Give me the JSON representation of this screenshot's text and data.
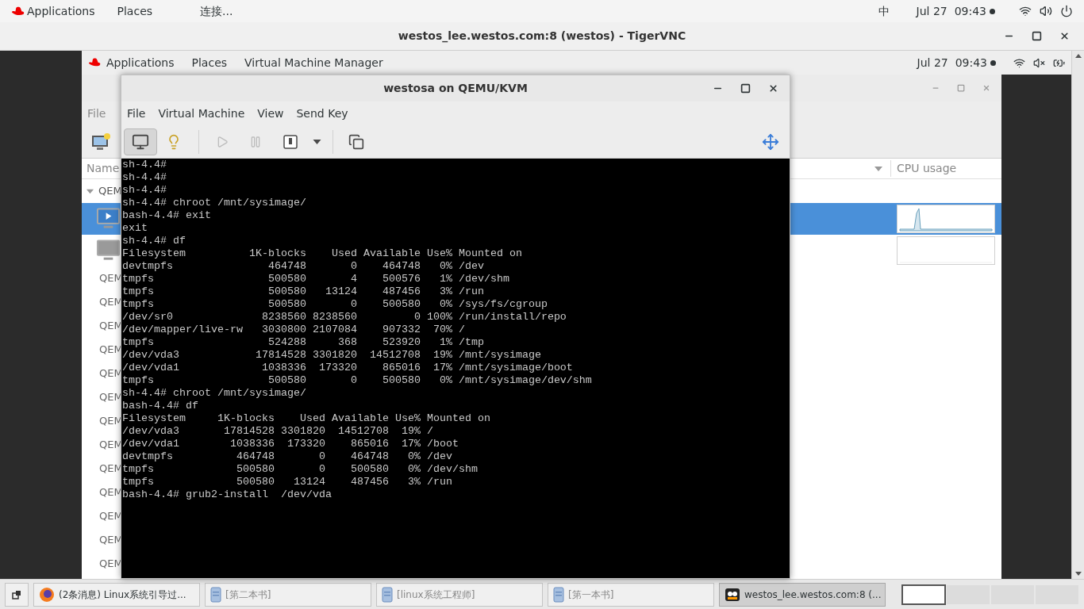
{
  "top_bar": {
    "menus": [
      "Applications",
      "Places"
    ],
    "app": "连接...",
    "input_method": "中",
    "clock": "Jul 27  09:43"
  },
  "vnc_window": {
    "title": "westos_lee.westos.com:8 (westos) - TigerVNC"
  },
  "remote_desktop": {
    "top_bar": {
      "menus": [
        "Applications",
        "Places",
        "Virtual Machine Manager"
      ],
      "clock": "Jul 27  09:43"
    },
    "manager_window": {
      "menus": [
        "File"
      ],
      "columns": [
        "Name",
        "CPU usage"
      ],
      "group": {
        "label": "QEM",
        "expanded": true
      },
      "vms": [
        {
          "selected": true,
          "running": true
        },
        {
          "selected": false,
          "running": false
        }
      ],
      "hosts": [
        "QEM",
        "QEM",
        "QEM",
        "QEM",
        "QEM",
        "QEM",
        "QEM",
        "QEM",
        "QEM",
        "QEM",
        "QEM",
        "QEM",
        "QEM"
      ]
    },
    "vm_window": {
      "title": "westosa on QEMU/KVM",
      "menus": [
        "File",
        "Virtual Machine",
        "View",
        "Send Key"
      ],
      "toolbar": [
        {
          "kind": "console",
          "selected": true,
          "disabled": false
        },
        {
          "kind": "details",
          "selected": false,
          "disabled": false
        },
        {
          "kind": "run",
          "selected": false,
          "disabled": true
        },
        {
          "kind": "pause",
          "selected": false,
          "disabled": true
        },
        {
          "kind": "shutdown",
          "selected": false,
          "disabled": false
        },
        {
          "kind": "menu",
          "selected": false,
          "disabled": false
        },
        {
          "kind": "snapshots",
          "selected": false,
          "disabled": false
        },
        {
          "kind": "fullscreen",
          "selected": false,
          "disabled": false
        }
      ],
      "console_lines": [
        "sh-4.4#",
        "sh-4.4#",
        "sh-4.4#",
        "sh-4.4# chroot /mnt/sysimage/",
        "bash-4.4# exit",
        "exit",
        "sh-4.4# df",
        "Filesystem          1K-blocks    Used Available Use% Mounted on",
        "devtmpfs               464748       0    464748   0% /dev",
        "tmpfs                  500580       4    500576   1% /dev/shm",
        "tmpfs                  500580   13124    487456   3% /run",
        "tmpfs                  500580       0    500580   0% /sys/fs/cgroup",
        "/dev/sr0              8238560 8238560         0 100% /run/install/repo",
        "/dev/mapper/live-rw   3030800 2107084    907332  70% /",
        "tmpfs                  524288     368    523920   1% /tmp",
        "/dev/vda3            17814528 3301820  14512708  19% /mnt/sysimage",
        "/dev/vda1             1038336  173320    865016  17% /mnt/sysimage/boot",
        "tmpfs                  500580       0    500580   0% /mnt/sysimage/dev/shm",
        "sh-4.4# chroot /mnt/sysimage/",
        "bash-4.4# df",
        "Filesystem     1K-blocks    Used Available Use% Mounted on",
        "/dev/vda3       17814528 3301820  14512708  19% /",
        "/dev/vda1        1038336  173320    865016  17% /boot",
        "devtmpfs          464748       0    464748   0% /dev",
        "tmpfs             500580       0    500580   0% /dev/shm",
        "tmpfs             500580   13124    487456   3% /run",
        "bash-4.4# grub2-install  /dev/vda"
      ]
    }
  },
  "taskbar": {
    "tasks": [
      {
        "kind": "browser",
        "label": "(2条消息) Linux系统引导过...",
        "selected": false
      },
      {
        "kind": "document",
        "label": "[第二本书]",
        "selected": false
      },
      {
        "kind": "document",
        "label": "[linux系统工程师]",
        "selected": false
      },
      {
        "kind": "document",
        "label": "[第一本书]",
        "selected": false
      },
      {
        "kind": "vnc",
        "label": "westos_lee.westos.com:8 (...",
        "selected": true
      }
    ],
    "workspaces": [
      {
        "selected": true
      },
      {
        "selected": false
      },
      {
        "selected": false
      },
      {
        "selected": false
      }
    ]
  }
}
